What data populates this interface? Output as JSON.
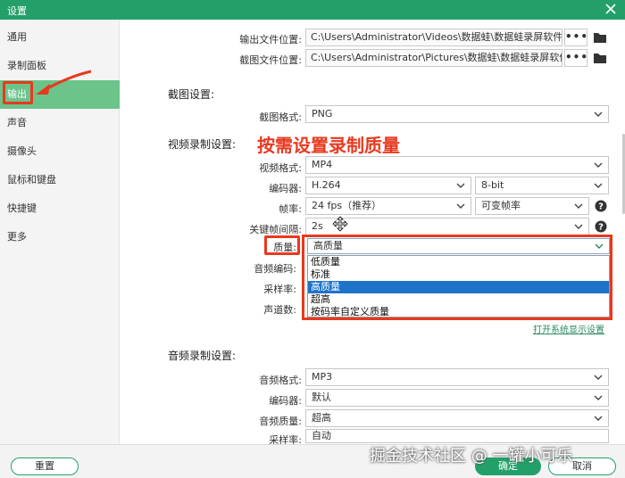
{
  "window": {
    "title": "设置"
  },
  "sidebar": {
    "items": [
      {
        "label": "通用"
      },
      {
        "label": "录制面板"
      },
      {
        "label": "输出"
      },
      {
        "label": "声音"
      },
      {
        "label": "摄像头"
      },
      {
        "label": "鼠标和键盘"
      },
      {
        "label": "快捷键"
      },
      {
        "label": "更多"
      }
    ],
    "active_index": 2
  },
  "paths": {
    "output_label": "输出文件位置:",
    "output_value": "C:\\Users\\Administrator\\Videos\\数据蛙\\数据蛙录屏软件",
    "screenshot_label": "截图文件位置:",
    "screenshot_value": "C:\\Users\\Administrator\\Pictures\\数据蛙\\数据蛙录屏软件",
    "browse_label": "•••"
  },
  "screenshot_settings": {
    "title": "截图设置:",
    "format_label": "截图格式:",
    "format_value": "PNG"
  },
  "video_settings": {
    "title": "视频录制设置:",
    "annotation": "按需设置录制质量",
    "format_label": "视频格式:",
    "format_value": "MP4",
    "encoder_label": "编码器:",
    "encoder_value": "H.264",
    "bitdepth_value": "8-bit",
    "framerate_label": "帧率:",
    "framerate_value": "24 fps（推荐）",
    "framerate_mode_value": "可变帧率",
    "keyframe_label": "关键帧间隔:",
    "keyframe_value": "2s",
    "quality_label": "质量:",
    "quality_value": "高质量",
    "quality_options": [
      "低质量",
      "标准",
      "高质量",
      "超高",
      "按码率自定义质量"
    ],
    "quality_selected_index": 2,
    "audio_codec_label": "音频编码:",
    "samplerate_label": "采样率:",
    "channels_label": "声道数:",
    "open_display_link": "打开系统显示设置"
  },
  "audio_settings": {
    "title": "音频录制设置:",
    "format_label": "音频格式:",
    "format_value": "MP3",
    "encoder_label": "编码器:",
    "encoder_value": "默认",
    "quality_label": "音频质量:",
    "quality_value": "超高",
    "samplerate_label": "采样率:",
    "samplerate_value": "自动"
  },
  "footer": {
    "reset_label": "重置",
    "ok_label": "确定",
    "cancel_label": "取消"
  },
  "watermark": "掘金技术社区 @ 一罐小可乐",
  "colors": {
    "brand_green": "#23a06a",
    "active_item": "#6cc48b",
    "annotation_red": "#e8391f",
    "selection_blue": "#1e73c9"
  }
}
